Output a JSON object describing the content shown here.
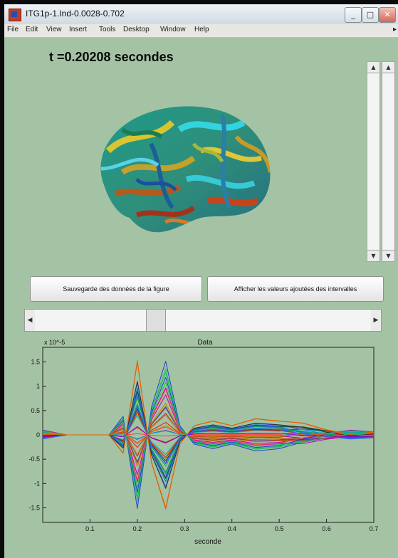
{
  "window": {
    "title": "ITG1p-1.Ind-0.0028-0.702",
    "controls": [
      "_",
      "□",
      "✕"
    ]
  },
  "menu": [
    "File",
    "Edit",
    "View",
    "Insert",
    "Tools",
    "Desktop",
    "Window",
    "Help"
  ],
  "time_label": "t =0.20208 secondes",
  "buttons": {
    "save_label": "Sauvegarde des données de la figure",
    "show_values_label": "Afficher les valeurs ajoutées des intervalles"
  },
  "colors": {
    "window_bg": "#a4c3a4"
  },
  "slider": {
    "position_fraction": 0.34
  },
  "chart_data": {
    "type": "line",
    "title": "Data",
    "xlabel": "seconde",
    "ylabel": "",
    "y_scale_note": "x 10^-5",
    "xlim": [
      0,
      0.7
    ],
    "ylim": [
      -1.8,
      1.8
    ],
    "xticks": [
      "0.1",
      "0.2",
      "0.3",
      "0.4",
      "0.5",
      "0.6",
      "0.7"
    ],
    "yticks": [
      "1.5",
      "1",
      "0.5",
      "0",
      "-0.5",
      "-1",
      "-1.5"
    ],
    "grid": false,
    "series_count": 40,
    "series_template": {
      "x": [
        0.0,
        0.05,
        0.1,
        0.14,
        0.17,
        0.2,
        0.23,
        0.26,
        0.29,
        0.32,
        0.36,
        0.4,
        0.45,
        0.5,
        0.55,
        0.6,
        0.65,
        0.7
      ],
      "y": [
        0.05,
        0.0,
        0.0,
        0.0,
        0.4,
        -1.6,
        0.6,
        1.6,
        0.2,
        -0.2,
        -0.3,
        -0.2,
        -0.35,
        -0.3,
        -0.2,
        -0.05,
        0.05,
        0.0
      ]
    }
  }
}
